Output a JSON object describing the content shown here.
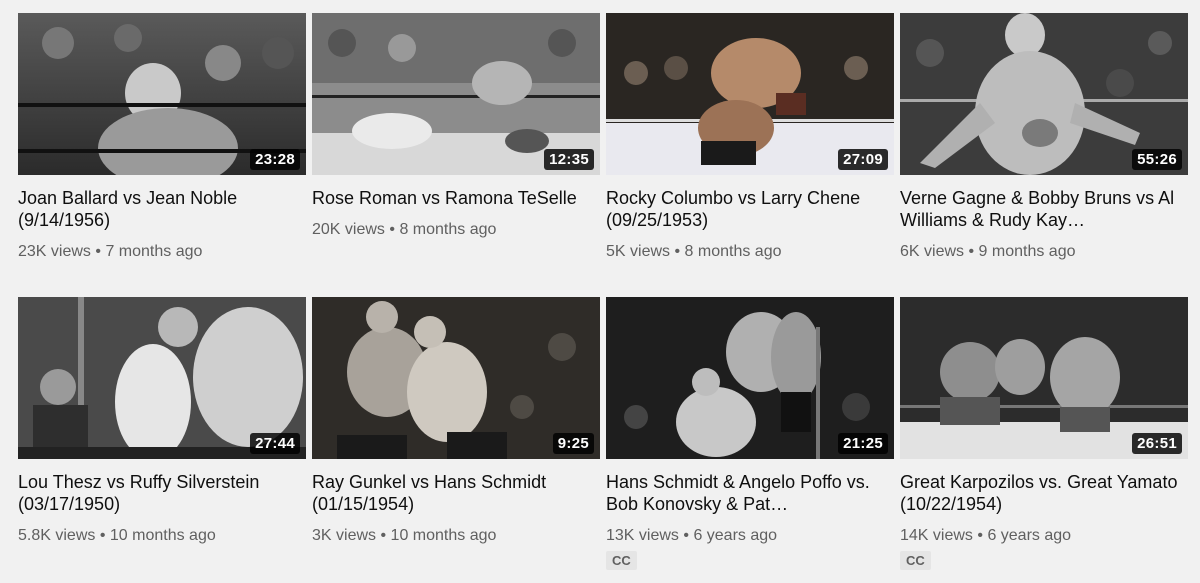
{
  "videos": [
    {
      "title": "Joan Ballard vs Jean Noble (9/14/1956)",
      "duration": "23:28",
      "views": "23K views",
      "age": "7 months ago",
      "cc": ""
    },
    {
      "title": "Rose Roman vs Ramona TeSelle",
      "duration": "12:35",
      "views": "20K views",
      "age": "8 months ago",
      "cc": ""
    },
    {
      "title": "Rocky Columbo vs Larry Chene (09/25/1953)",
      "duration": "27:09",
      "views": "5K views",
      "age": "8 months ago",
      "cc": ""
    },
    {
      "title": "Verne Gagne & Bobby Bruns vs Al Williams & Rudy Kay…",
      "duration": "55:26",
      "views": "6K views",
      "age": "9 months ago",
      "cc": ""
    },
    {
      "title": "Lou Thesz vs Ruffy Silverstein (03/17/1950)",
      "duration": "27:44",
      "views": "5.8K views",
      "age": "10 months ago",
      "cc": ""
    },
    {
      "title": "Ray Gunkel vs Hans Schmidt (01/15/1954)",
      "duration": "9:25",
      "views": "3K views",
      "age": "10 months ago",
      "cc": ""
    },
    {
      "title": "Hans Schmidt & Angelo Poffo vs. Bob Konovsky & Pat…",
      "duration": "21:25",
      "views": "13K views",
      "age": "6 years ago",
      "cc": "CC"
    },
    {
      "title": "Great Karpozilos vs. Great Yamato (10/22/1954)",
      "duration": "26:51",
      "views": "14K views",
      "age": "6 years ago",
      "cc": "CC"
    }
  ],
  "separator": "•",
  "colors": {
    "background": "#f1f1f1",
    "title": "#0f0f0f",
    "meta": "#606060"
  },
  "thumbnail_tone": "black-and-white wrestling film still"
}
